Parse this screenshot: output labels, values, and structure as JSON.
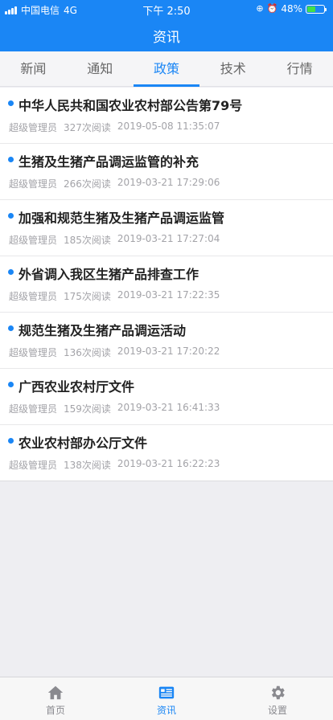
{
  "status_bar": {
    "carrier": "中国电信",
    "network": "4G",
    "time": "下午 2:50",
    "battery": "48%",
    "battery_level": 0.48
  },
  "header": {
    "title": "资讯"
  },
  "tabs": [
    {
      "label": "新闻"
    },
    {
      "label": "通知"
    },
    {
      "label": "政策"
    },
    {
      "label": "技术"
    },
    {
      "label": "行情"
    }
  ],
  "articles": [
    {
      "title": "中华人民共和国农业农村部公告第79号",
      "author": "超级管理员",
      "reads": "327次阅读",
      "date": "2019-05-08 11:35:07"
    },
    {
      "title": "生猪及生猪产品调运监管的补充",
      "author": "超级管理员",
      "reads": "266次阅读",
      "date": "2019-03-21 17:29:06"
    },
    {
      "title": "加强和规范生猪及生猪产品调运监管",
      "author": "超级管理员",
      "reads": "185次阅读",
      "date": "2019-03-21 17:27:04"
    },
    {
      "title": "外省调入我区生猪产品排查工作",
      "author": "超级管理员",
      "reads": "175次阅读",
      "date": "2019-03-21 17:22:35"
    },
    {
      "title": "规范生猪及生猪产品调运活动",
      "author": "超级管理员",
      "reads": "136次阅读",
      "date": "2019-03-21 17:20:22"
    },
    {
      "title": "广西农业农村厅文件",
      "author": "超级管理员",
      "reads": "159次阅读",
      "date": "2019-03-21 16:41:33"
    },
    {
      "title": "农业农村部办公厅文件",
      "author": "超级管理员",
      "reads": "138次阅读",
      "date": "2019-03-21 16:22:23"
    }
  ],
  "tabbar": [
    {
      "label": "首页",
      "icon": "home-icon"
    },
    {
      "label": "资讯",
      "icon": "news-icon"
    },
    {
      "label": "设置",
      "icon": "gear-icon"
    }
  ],
  "colors": {
    "accent": "#1a86f5",
    "battery": "#43e047"
  }
}
